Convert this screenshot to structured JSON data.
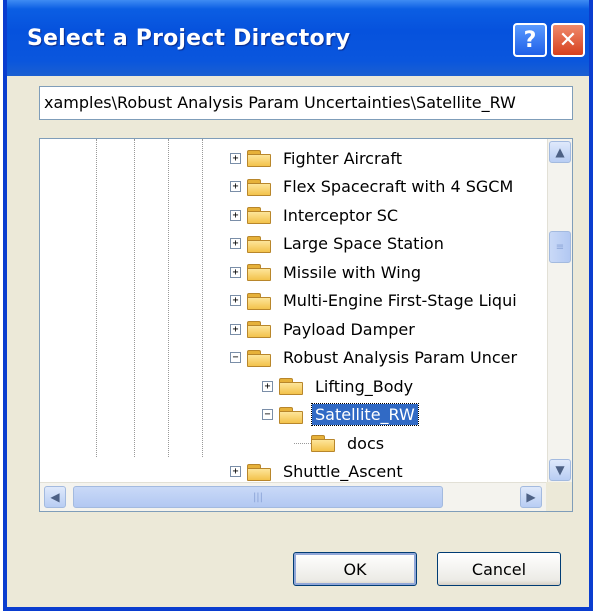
{
  "window": {
    "title": "Select a Project Directory"
  },
  "titlebar_buttons": {
    "help_label": "?",
    "close_label": "✕"
  },
  "path": {
    "value": "xamples\\Robust Analysis Param Uncertainties\\Satellite_RW"
  },
  "tree": {
    "items": [
      {
        "label": "Fighter Aircraft",
        "expander": "+",
        "level": 1
      },
      {
        "label": "Flex Spacecraft with 4 SGCM",
        "expander": "+",
        "level": 1
      },
      {
        "label": "Interceptor SC",
        "expander": "+",
        "level": 1
      },
      {
        "label": "Large Space Station",
        "expander": "+",
        "level": 1
      },
      {
        "label": "Missile with Wing",
        "expander": "+",
        "level": 1
      },
      {
        "label": "Multi-Engine First-Stage Liqui",
        "expander": "+",
        "level": 1
      },
      {
        "label": "Payload Damper",
        "expander": "+",
        "level": 1
      },
      {
        "label": "Robust Analysis Param Uncer",
        "expander": "−",
        "level": 1
      },
      {
        "label": "Lifting_Body",
        "expander": "+",
        "level": 2
      },
      {
        "label": "Satellite_RW",
        "expander": "−",
        "level": 2,
        "selected": true
      },
      {
        "label": "docs",
        "expander": "",
        "level": 3
      },
      {
        "label": "Shuttle_Ascent",
        "expander": "+",
        "level": 1
      }
    ]
  },
  "scrollbar": {
    "up": "▲",
    "down": "▼",
    "left": "◀",
    "right": "▶",
    "grip_v": "≡",
    "grip_h": "|||"
  },
  "buttons": {
    "ok": "OK",
    "cancel": "Cancel"
  }
}
